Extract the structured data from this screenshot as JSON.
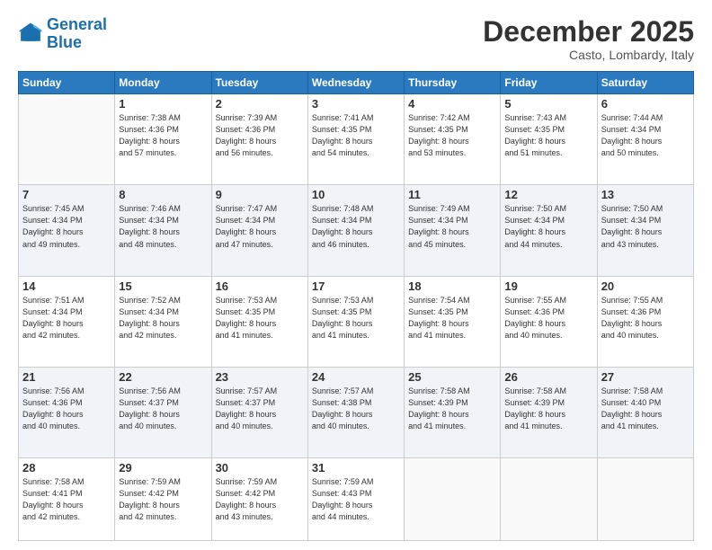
{
  "header": {
    "logo_general": "General",
    "logo_blue": "Blue",
    "month": "December 2025",
    "location": "Casto, Lombardy, Italy"
  },
  "weekdays": [
    "Sunday",
    "Monday",
    "Tuesday",
    "Wednesday",
    "Thursday",
    "Friday",
    "Saturday"
  ],
  "weeks": [
    [
      {
        "day": "",
        "info": ""
      },
      {
        "day": "1",
        "info": "Sunrise: 7:38 AM\nSunset: 4:36 PM\nDaylight: 8 hours\nand 57 minutes."
      },
      {
        "day": "2",
        "info": "Sunrise: 7:39 AM\nSunset: 4:36 PM\nDaylight: 8 hours\nand 56 minutes."
      },
      {
        "day": "3",
        "info": "Sunrise: 7:41 AM\nSunset: 4:35 PM\nDaylight: 8 hours\nand 54 minutes."
      },
      {
        "day": "4",
        "info": "Sunrise: 7:42 AM\nSunset: 4:35 PM\nDaylight: 8 hours\nand 53 minutes."
      },
      {
        "day": "5",
        "info": "Sunrise: 7:43 AM\nSunset: 4:35 PM\nDaylight: 8 hours\nand 51 minutes."
      },
      {
        "day": "6",
        "info": "Sunrise: 7:44 AM\nSunset: 4:34 PM\nDaylight: 8 hours\nand 50 minutes."
      }
    ],
    [
      {
        "day": "7",
        "info": "Sunrise: 7:45 AM\nSunset: 4:34 PM\nDaylight: 8 hours\nand 49 minutes."
      },
      {
        "day": "8",
        "info": "Sunrise: 7:46 AM\nSunset: 4:34 PM\nDaylight: 8 hours\nand 48 minutes."
      },
      {
        "day": "9",
        "info": "Sunrise: 7:47 AM\nSunset: 4:34 PM\nDaylight: 8 hours\nand 47 minutes."
      },
      {
        "day": "10",
        "info": "Sunrise: 7:48 AM\nSunset: 4:34 PM\nDaylight: 8 hours\nand 46 minutes."
      },
      {
        "day": "11",
        "info": "Sunrise: 7:49 AM\nSunset: 4:34 PM\nDaylight: 8 hours\nand 45 minutes."
      },
      {
        "day": "12",
        "info": "Sunrise: 7:50 AM\nSunset: 4:34 PM\nDaylight: 8 hours\nand 44 minutes."
      },
      {
        "day": "13",
        "info": "Sunrise: 7:50 AM\nSunset: 4:34 PM\nDaylight: 8 hours\nand 43 minutes."
      }
    ],
    [
      {
        "day": "14",
        "info": "Sunrise: 7:51 AM\nSunset: 4:34 PM\nDaylight: 8 hours\nand 42 minutes."
      },
      {
        "day": "15",
        "info": "Sunrise: 7:52 AM\nSunset: 4:34 PM\nDaylight: 8 hours\nand 42 minutes."
      },
      {
        "day": "16",
        "info": "Sunrise: 7:53 AM\nSunset: 4:35 PM\nDaylight: 8 hours\nand 41 minutes."
      },
      {
        "day": "17",
        "info": "Sunrise: 7:53 AM\nSunset: 4:35 PM\nDaylight: 8 hours\nand 41 minutes."
      },
      {
        "day": "18",
        "info": "Sunrise: 7:54 AM\nSunset: 4:35 PM\nDaylight: 8 hours\nand 41 minutes."
      },
      {
        "day": "19",
        "info": "Sunrise: 7:55 AM\nSunset: 4:36 PM\nDaylight: 8 hours\nand 40 minutes."
      },
      {
        "day": "20",
        "info": "Sunrise: 7:55 AM\nSunset: 4:36 PM\nDaylight: 8 hours\nand 40 minutes."
      }
    ],
    [
      {
        "day": "21",
        "info": "Sunrise: 7:56 AM\nSunset: 4:36 PM\nDaylight: 8 hours\nand 40 minutes."
      },
      {
        "day": "22",
        "info": "Sunrise: 7:56 AM\nSunset: 4:37 PM\nDaylight: 8 hours\nand 40 minutes."
      },
      {
        "day": "23",
        "info": "Sunrise: 7:57 AM\nSunset: 4:37 PM\nDaylight: 8 hours\nand 40 minutes."
      },
      {
        "day": "24",
        "info": "Sunrise: 7:57 AM\nSunset: 4:38 PM\nDaylight: 8 hours\nand 40 minutes."
      },
      {
        "day": "25",
        "info": "Sunrise: 7:58 AM\nSunset: 4:39 PM\nDaylight: 8 hours\nand 41 minutes."
      },
      {
        "day": "26",
        "info": "Sunrise: 7:58 AM\nSunset: 4:39 PM\nDaylight: 8 hours\nand 41 minutes."
      },
      {
        "day": "27",
        "info": "Sunrise: 7:58 AM\nSunset: 4:40 PM\nDaylight: 8 hours\nand 41 minutes."
      }
    ],
    [
      {
        "day": "28",
        "info": "Sunrise: 7:58 AM\nSunset: 4:41 PM\nDaylight: 8 hours\nand 42 minutes."
      },
      {
        "day": "29",
        "info": "Sunrise: 7:59 AM\nSunset: 4:42 PM\nDaylight: 8 hours\nand 42 minutes."
      },
      {
        "day": "30",
        "info": "Sunrise: 7:59 AM\nSunset: 4:42 PM\nDaylight: 8 hours\nand 43 minutes."
      },
      {
        "day": "31",
        "info": "Sunrise: 7:59 AM\nSunset: 4:43 PM\nDaylight: 8 hours\nand 44 minutes."
      },
      {
        "day": "",
        "info": ""
      },
      {
        "day": "",
        "info": ""
      },
      {
        "day": "",
        "info": ""
      }
    ]
  ]
}
